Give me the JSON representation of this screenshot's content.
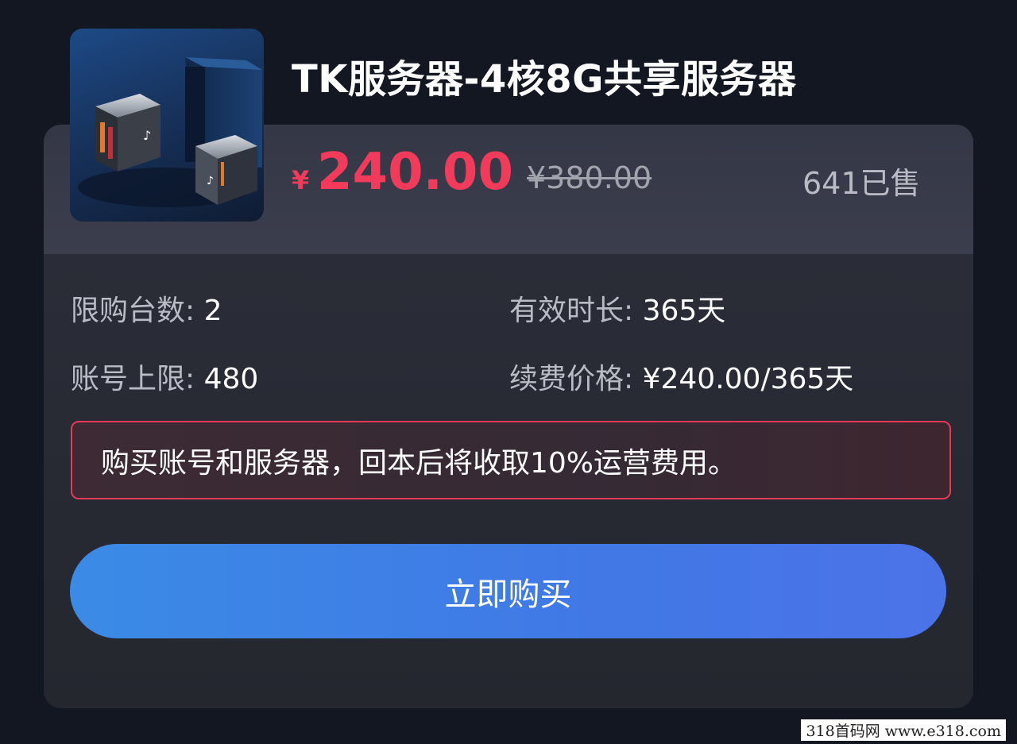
{
  "product": {
    "title": "TK服务器-4核8G共享服务器",
    "price_symbol": "¥",
    "price": "240.00",
    "original_price": "¥380.00",
    "sold": "641已售"
  },
  "details": {
    "limit_label": "限购台数: ",
    "limit_value": "2",
    "duration_label": "有效时长: ",
    "duration_value": "365天",
    "account_label": "账号上限: ",
    "account_value": "480",
    "renew_label": "续费价格: ",
    "renew_value": "¥240.00/365天"
  },
  "notice": "购买账号和服务器，回本后将收取10%运营费用。",
  "buy_button": "立即购买",
  "watermark": "318首码网  www.e318.com",
  "colors": {
    "accent": "#f23a5a",
    "button": "#3f82e6",
    "background": "#131722"
  }
}
